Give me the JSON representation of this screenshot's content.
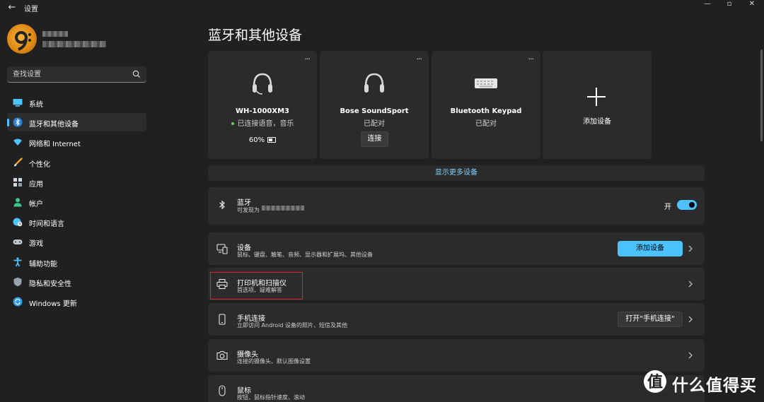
{
  "window": {
    "title": "设置"
  },
  "search": {
    "placeholder": "查找设置"
  },
  "nav": [
    {
      "label": "系统",
      "icon": "monitor-icon",
      "color": "#4cc2ff"
    },
    {
      "label": "蓝牙和其他设备",
      "icon": "bluetooth-icon",
      "color": "#4cc2ff",
      "active": true
    },
    {
      "label": "网络和 Internet",
      "icon": "wifi-icon",
      "color": "#4cc2ff"
    },
    {
      "label": "个性化",
      "icon": "brush-icon",
      "color": "#f2a033"
    },
    {
      "label": "应用",
      "icon": "apps-icon",
      "color": "#cfd8e0"
    },
    {
      "label": "帐户",
      "icon": "person-icon",
      "color": "#3cc88a"
    },
    {
      "label": "时间和语言",
      "icon": "globe-clock-icon",
      "color": "#4cc2ff"
    },
    {
      "label": "游戏",
      "icon": "gamepad-icon",
      "color": "#bfc7cf"
    },
    {
      "label": "辅助功能",
      "icon": "accessibility-icon",
      "color": "#4cc2ff"
    },
    {
      "label": "隐私和安全性",
      "icon": "shield-icon",
      "color": "#9aa4ae"
    },
    {
      "label": "Windows 更新",
      "icon": "update-icon",
      "color": "#2b9ce8"
    }
  ],
  "main": {
    "title": "蓝牙和其他设备",
    "devices": [
      {
        "name": "WH-1000XM3",
        "status": "已连接语音，音乐",
        "battery": "60%",
        "icon": "headphones-icon",
        "connected": true
      },
      {
        "name": "Bose SoundSport",
        "status": "已配对",
        "action": "连接",
        "icon": "headphones-icon"
      },
      {
        "name": "Bluetooth Keypad",
        "status": "已配对",
        "icon": "keyboard-icon"
      }
    ],
    "more_glyph": "···",
    "add_device_card": {
      "label": "添加设备"
    },
    "show_more": "显示更多设备",
    "bluetooth": {
      "title": "蓝牙",
      "subtitle": "可发现为",
      "toggle_label": "开",
      "on": true
    },
    "rows": [
      {
        "title": "设备",
        "subtitle": "鼠标、键盘、触笔、音频、显示器和扩展坞、其他设备",
        "button": "添加设备",
        "icon": "devices-icon"
      },
      {
        "title": "打印机和扫描仪",
        "subtitle": "首选项、疑难解答",
        "icon": "printer-icon"
      },
      {
        "title": "手机连接",
        "subtitle": "立即访问 Android 设备的照片、短信及其他",
        "button": "打开\"手机连接\"",
        "icon": "phone-icon"
      },
      {
        "title": "摄像头",
        "subtitle": "连接的摄像头、默认图像设置",
        "icon": "camera-icon"
      },
      {
        "title": "鼠标",
        "subtitle": "按钮、鼠标指针速度、滚动",
        "icon": "mouse-icon"
      }
    ]
  },
  "watermark": {
    "text": "什么值得买"
  },
  "colors": {
    "accent": "#4cc2ff",
    "highlight_box": "#e0232d",
    "background": "#202020",
    "card": "#2b2b2b"
  }
}
